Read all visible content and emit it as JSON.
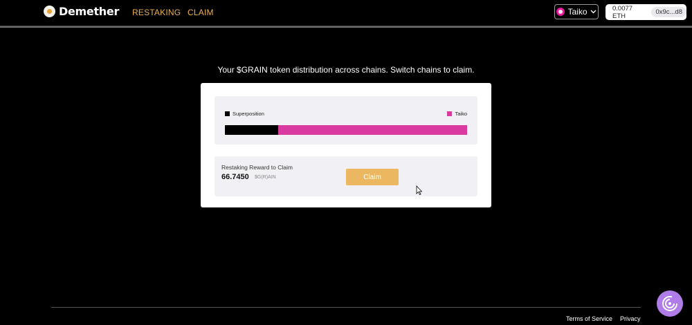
{
  "header": {
    "logo_text": "Demether",
    "nav": [
      {
        "label": "RESTAKING"
      },
      {
        "label": "CLAIM"
      }
    ],
    "chain_selector": {
      "label": "Taiko",
      "icon": "taiko-icon",
      "color": "#e81899"
    },
    "wallet": {
      "balance": "0.0077 ETH",
      "address": "0x9c...d8"
    }
  },
  "main": {
    "subtitle": "Your $GRAIN token distribution across chains. Switch chains to claim.",
    "distribution": {
      "legend": [
        {
          "label": "Superposition",
          "color": "#000000"
        },
        {
          "label": "Taiko",
          "color": "#d93a9f"
        }
      ],
      "shares": [
        {
          "chain": "Superposition",
          "fraction": 0.22,
          "color": "#000000"
        },
        {
          "chain": "Taiko",
          "fraction": 0.78,
          "color": "#d93a9f"
        }
      ]
    },
    "claim": {
      "label": "Restaking Reward to Claim",
      "amount": "66.7450",
      "unit": "$G(R)AIN",
      "button_label": "Claim"
    }
  },
  "footer": {
    "links": [
      {
        "label": "Terms of Service"
      },
      {
        "label": "Privacy"
      }
    ]
  },
  "colors": {
    "accent": "#e9b04f",
    "claim_button": "#ebb861",
    "help_button": "#b07ce8"
  }
}
